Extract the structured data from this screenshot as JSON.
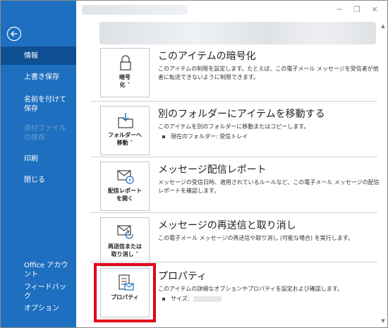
{
  "window": {
    "minimize_glyph": "─",
    "restore_glyph": "❐",
    "close_glyph": "✕"
  },
  "sidebar": {
    "back_icon": "back-arrow-icon",
    "items": [
      {
        "label": "情報",
        "state": "selected"
      },
      {
        "label": "上書き保存",
        "state": "normal"
      },
      {
        "label": "名前を付けて保存",
        "state": "normal"
      },
      {
        "label": "添付ファイルの保存",
        "state": "disabled"
      },
      {
        "label": "印刷",
        "state": "normal"
      },
      {
        "label": "閉じる",
        "state": "normal"
      },
      {
        "label": "Office アカウント",
        "state": "normal"
      },
      {
        "label": "フィードバック",
        "state": "normal"
      },
      {
        "label": "オプション",
        "state": "normal"
      }
    ]
  },
  "sections": [
    {
      "tile_label": "暗号\n化 ˅",
      "icon": "lock-icon",
      "title": "このアイテムの暗号化",
      "description": "このアイテムの制限を設定します。たとえば、この電子メール メッセージを受信者が他者に転送できないように制限できます。"
    },
    {
      "tile_label": "フォルダーへ\n移動 ˅",
      "icon": "move-to-folder-icon",
      "title": "別のフォルダーにアイテムを移動する",
      "description": "このアイテムを別のフォルダーに移動またはコピーします。",
      "bullet": "現在のフォルダー:   受信トレイ"
    },
    {
      "tile_label": "配信レポート\nを開く",
      "icon": "delivery-report-icon",
      "title": "メッセージ配信レポート",
      "description": "メッセージの受信日時、適用されているルールなど、この電子メール メッセージの配信レポートを確認します。"
    },
    {
      "tile_label": "再送信または\n取り消し ˅",
      "icon": "resend-recall-icon",
      "title": "メッセージの再送信と取り消し",
      "description": "この電子メール メッセージの再送信や取り消し (可能な場合) を実行します。"
    },
    {
      "tile_label": "プロパティ",
      "icon": "properties-icon",
      "title": "プロパティ",
      "description": "このアイテムの詳細なオプションやプロパティを設定および確認します。",
      "bullet": "サイズ:"
    }
  ],
  "colors": {
    "sidebar_bg": "#1e6fbf",
    "sidebar_selected": "#0f4f94",
    "highlight": "#e3001b"
  }
}
